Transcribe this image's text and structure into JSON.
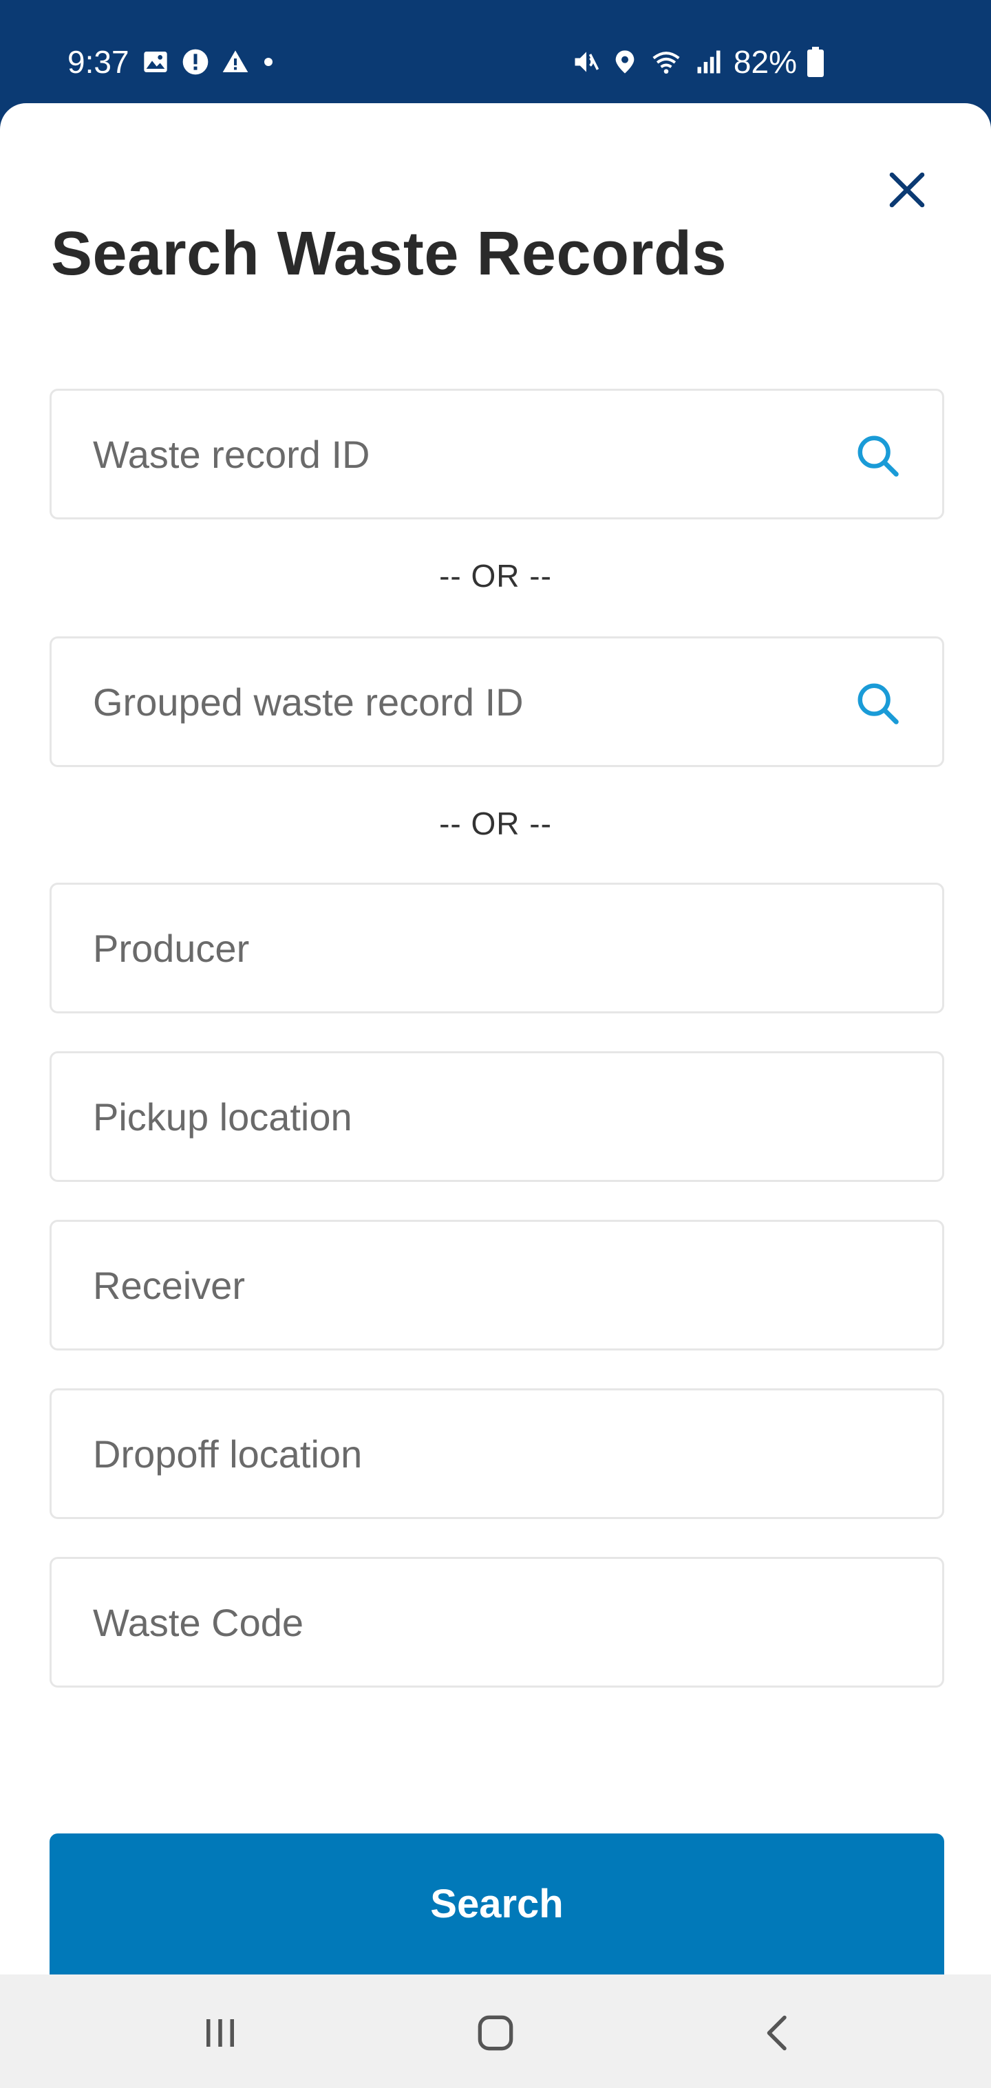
{
  "status_bar": {
    "time": "9:37",
    "battery": "82%",
    "left_icons": [
      "image-icon",
      "alert-icon",
      "warning-icon",
      "dot-icon"
    ],
    "right_icons": [
      "mute-icon",
      "location-icon",
      "wifi-icon",
      "signal-icon",
      "battery-icon"
    ]
  },
  "sheet": {
    "title": "Search Waste Records",
    "close_icon": "close-icon"
  },
  "fields": {
    "waste_record_id": {
      "placeholder": "Waste record ID",
      "value": ""
    },
    "grouped_waste_record_id": {
      "placeholder": "Grouped waste record ID",
      "value": ""
    },
    "producer": {
      "placeholder": "Producer",
      "value": ""
    },
    "pickup_location": {
      "placeholder": "Pickup location",
      "value": ""
    },
    "receiver": {
      "placeholder": "Receiver",
      "value": ""
    },
    "dropoff_location": {
      "placeholder": "Dropoff location",
      "value": ""
    },
    "waste_code": {
      "placeholder": "Waste Code",
      "value": ""
    }
  },
  "dividers": {
    "or_label": "-- OR --"
  },
  "actions": {
    "search_label": "Search"
  },
  "nav_bar": {
    "icons": [
      "recent-apps-icon",
      "home-icon",
      "back-icon"
    ]
  },
  "colors": {
    "status_bar_bg": "#0b3a73",
    "accent": "#0179b9",
    "search_icon": "#1a9bd7",
    "close_icon": "#0b3a73",
    "title_text": "#2a2a2a",
    "field_border": "#e6e6e6",
    "nav_bar_bg": "#f0f0f0"
  }
}
